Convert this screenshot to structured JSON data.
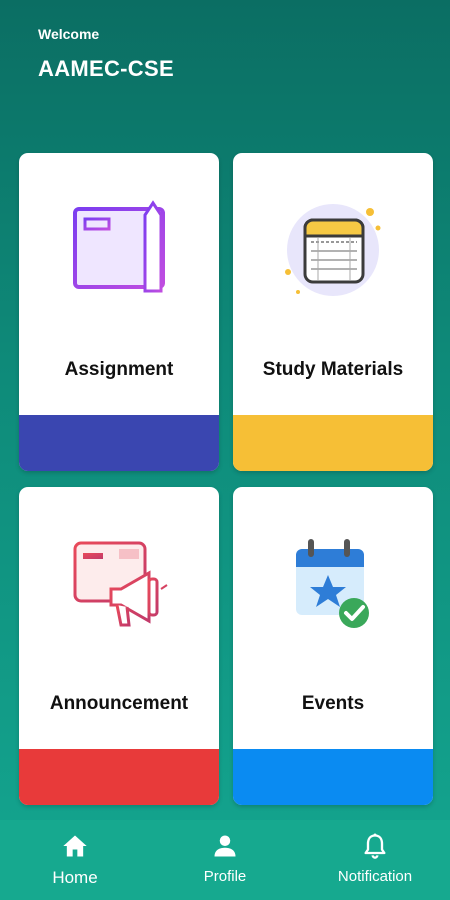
{
  "header": {
    "welcome": "Welcome",
    "title": "AAMEC-CSE"
  },
  "cards": [
    {
      "label": "Assignment",
      "icon": "assignment-book-icon",
      "bar_color": "#3a46b0"
    },
    {
      "label": "Study Materials",
      "icon": "notepad-icon",
      "bar_color": "#f6bf36"
    },
    {
      "label": "Announcement",
      "icon": "megaphone-icon",
      "bar_color": "#e83a3a"
    },
    {
      "label": "Events",
      "icon": "calendar-check-icon",
      "bar_color": "#0a8bf2"
    }
  ],
  "bottom_nav": {
    "items": [
      {
        "label": "Home",
        "icon": "home-icon",
        "active": true
      },
      {
        "label": "Profile",
        "icon": "person-icon",
        "active": false
      },
      {
        "label": "Notification",
        "icon": "bell-icon",
        "active": false
      }
    ]
  },
  "colors": {
    "background_top": "#0b6e63",
    "background_bottom": "#14a690",
    "nav_background": "#16a98f"
  }
}
